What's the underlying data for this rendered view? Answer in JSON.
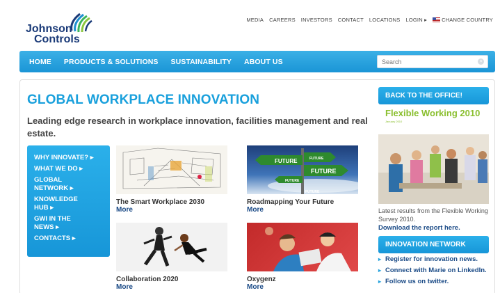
{
  "brand": {
    "line1": "Johnson",
    "line2": "Controls"
  },
  "utility_nav": [
    "MEDIA",
    "CAREERS",
    "INVESTORS",
    "CONTACT",
    "LOCATIONS",
    "LOGIN ▸",
    "CHANGE COUNTRY"
  ],
  "main_nav": [
    "HOME",
    "PRODUCTS & SOLUTIONS",
    "SUSTAINABILITY",
    "ABOUT US"
  ],
  "search": {
    "placeholder": "Search"
  },
  "page": {
    "title": "GLOBAL WORKPLACE INNOVATION",
    "subtitle": "Leading edge research in workplace innovation, facilities management and real estate."
  },
  "side_menu": [
    "WHY INNOVATE? ▸",
    "WHAT WE DO ▸",
    "GLOBAL NETWORK ▸",
    "KNOWLEDGE HUB ▸",
    "GWI IN THE NEWS ▸",
    "CONTACTS ▸"
  ],
  "tiles": [
    {
      "title": "The Smart Workplace 2030",
      "more": "More"
    },
    {
      "title": "Roadmapping Your Future",
      "more": "More"
    },
    {
      "title": "Collaboration 2020",
      "more": "More"
    },
    {
      "title": "Oxygenz",
      "more": "More"
    }
  ],
  "roadmap_signs": [
    "FUTURE",
    "FUTURE",
    "FUTURE",
    "FUTURE",
    "FUTURE"
  ],
  "right": {
    "back_button": "BACK TO THE OFFICE!",
    "fw_title": "Flexible Working 2010",
    "fw_date": "January 2010",
    "caption": "Latest results from the Flexible Working Survey 2010.",
    "download": "Download the report here.",
    "network_button": "INNOVATION NETWORK",
    "network_links": [
      "Register for innovation news.",
      "Connect with Marie on LinkedIn.",
      "Follow us on twitter."
    ]
  },
  "colors": {
    "accent": "#1a9ddc",
    "link": "#1a4a86",
    "green": "#8abf2f"
  }
}
